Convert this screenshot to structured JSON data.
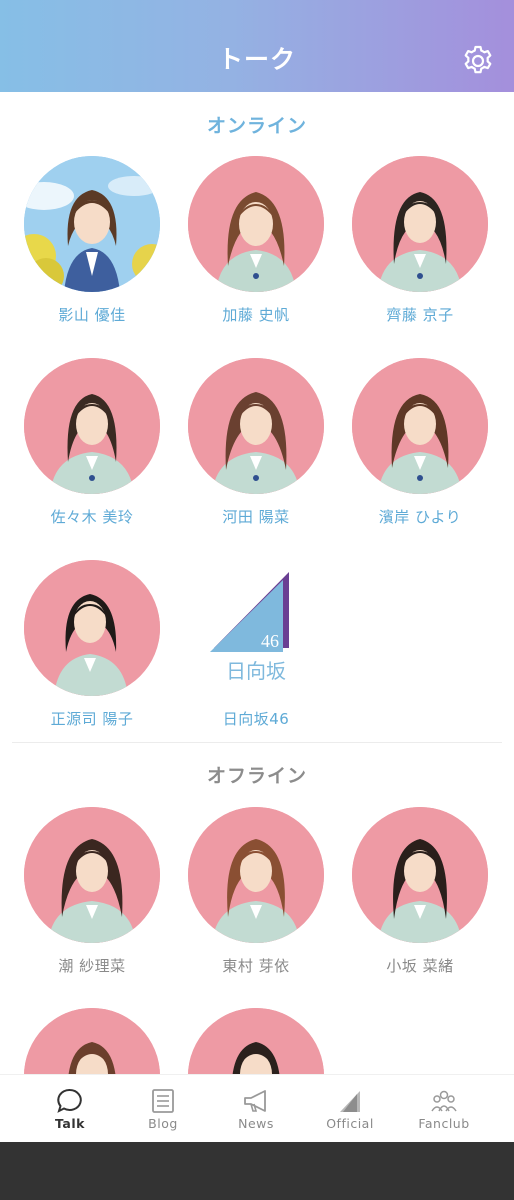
{
  "header": {
    "title": "トーク",
    "settings_icon": "gear-icon"
  },
  "sections": {
    "online": "オンライン",
    "offline": "オフライン"
  },
  "online_members": [
    {
      "name": "影山 優佳"
    },
    {
      "name": "加藤 史帆"
    },
    {
      "name": "齊藤 京子"
    },
    {
      "name": "佐々木 美玲"
    },
    {
      "name": "河田 陽菜"
    },
    {
      "name": "濱岸 ひより"
    },
    {
      "name": "正源司 陽子"
    },
    {
      "name": "日向坂46",
      "logo_text": "日向坂",
      "logo_number": "46"
    }
  ],
  "offline_members": [
    {
      "name": "潮 紗理菜"
    },
    {
      "name": "東村 芽依"
    },
    {
      "name": "小坂 菜緒"
    },
    {
      "name": ""
    },
    {
      "name": ""
    }
  ],
  "bottom_nav": [
    {
      "label": "Talk",
      "icon": "chat-bubble-icon",
      "active": true
    },
    {
      "label": "Blog",
      "icon": "document-icon",
      "active": false
    },
    {
      "label": "News",
      "icon": "megaphone-icon",
      "active": false
    },
    {
      "label": "Official",
      "icon": "triangle-logo-icon",
      "active": false
    },
    {
      "label": "Fanclub",
      "icon": "group-icon",
      "active": false
    }
  ],
  "colors": {
    "header_gradient_start": "#86bfe6",
    "header_gradient_end": "#a48fdc",
    "online_accent": "#6fb3dd",
    "avatar_background": "#ee9aa4",
    "logo_blue": "#7fb9dd",
    "logo_purple": "#6a3f93"
  }
}
